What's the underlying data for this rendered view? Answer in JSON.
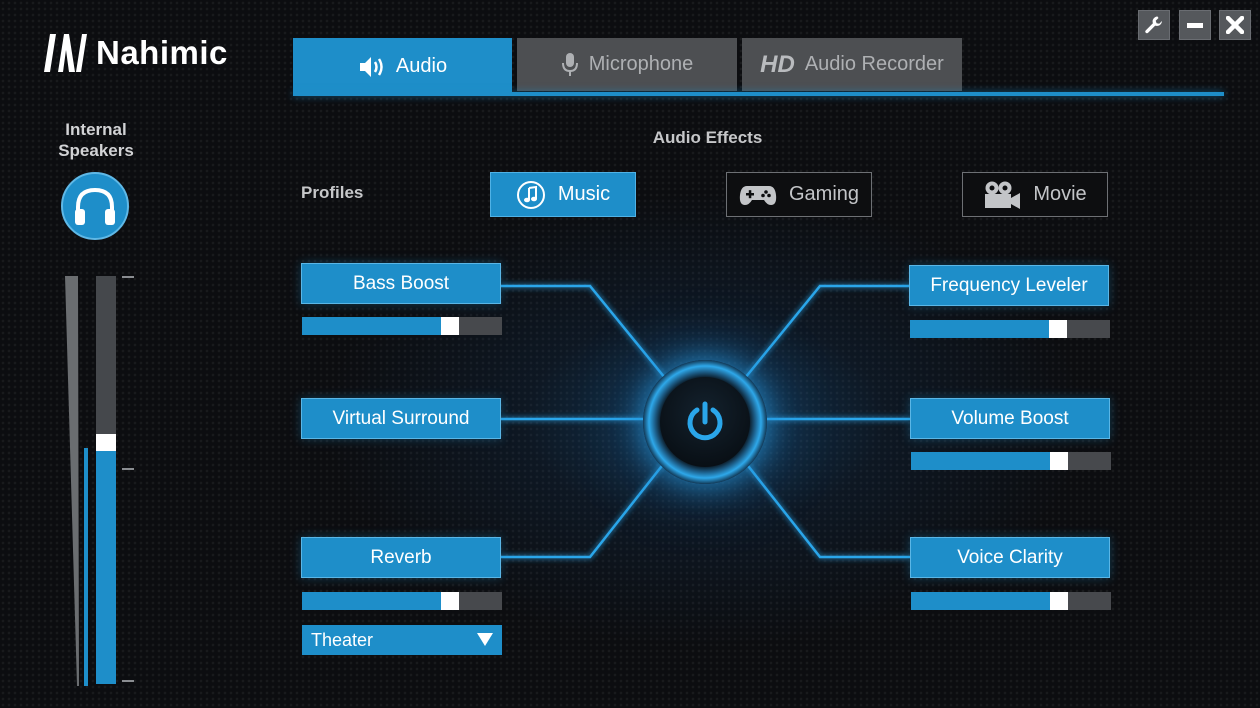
{
  "app": {
    "name": "Nahimic"
  },
  "window_controls": {
    "settings": "wrench-icon",
    "minimize": "minimize-icon",
    "close": "close-icon"
  },
  "tabs": [
    {
      "label": "Audio",
      "icon": "speaker-icon",
      "active": true
    },
    {
      "label": "Microphone",
      "icon": "microphone-icon",
      "active": false
    },
    {
      "label": "Audio Recorder",
      "prefix": "HD",
      "active": false
    }
  ],
  "device": {
    "label_line1": "Internal",
    "label_line2": "Speakers",
    "icon": "headphones-icon"
  },
  "master_volume": {
    "level": 0.59
  },
  "effects_title": "Audio Effects",
  "profiles": {
    "label": "Profiles",
    "options": [
      {
        "label": "Music",
        "icon": "music-note-icon",
        "active": true
      },
      {
        "label": "Gaming",
        "icon": "gamepad-icon",
        "active": false
      },
      {
        "label": "Movie",
        "icon": "video-camera-icon",
        "active": false
      }
    ]
  },
  "effects": {
    "bass_boost": {
      "label": "Bass Boost",
      "level": 0.74
    },
    "virtual_surround": {
      "label": "Virtual Surround"
    },
    "reverb": {
      "label": "Reverb",
      "level": 0.74,
      "preset": "Theater"
    },
    "frequency_leveler": {
      "label": "Frequency Leveler",
      "level": 0.74
    },
    "volume_boost": {
      "label": "Volume Boost",
      "level": 0.74
    },
    "voice_clarity": {
      "label": "Voice Clarity",
      "level": 0.74
    }
  },
  "colors": {
    "accent": "#1e8ec9",
    "inactive_tab": "#4d4f52",
    "background": "#0c0d10"
  }
}
